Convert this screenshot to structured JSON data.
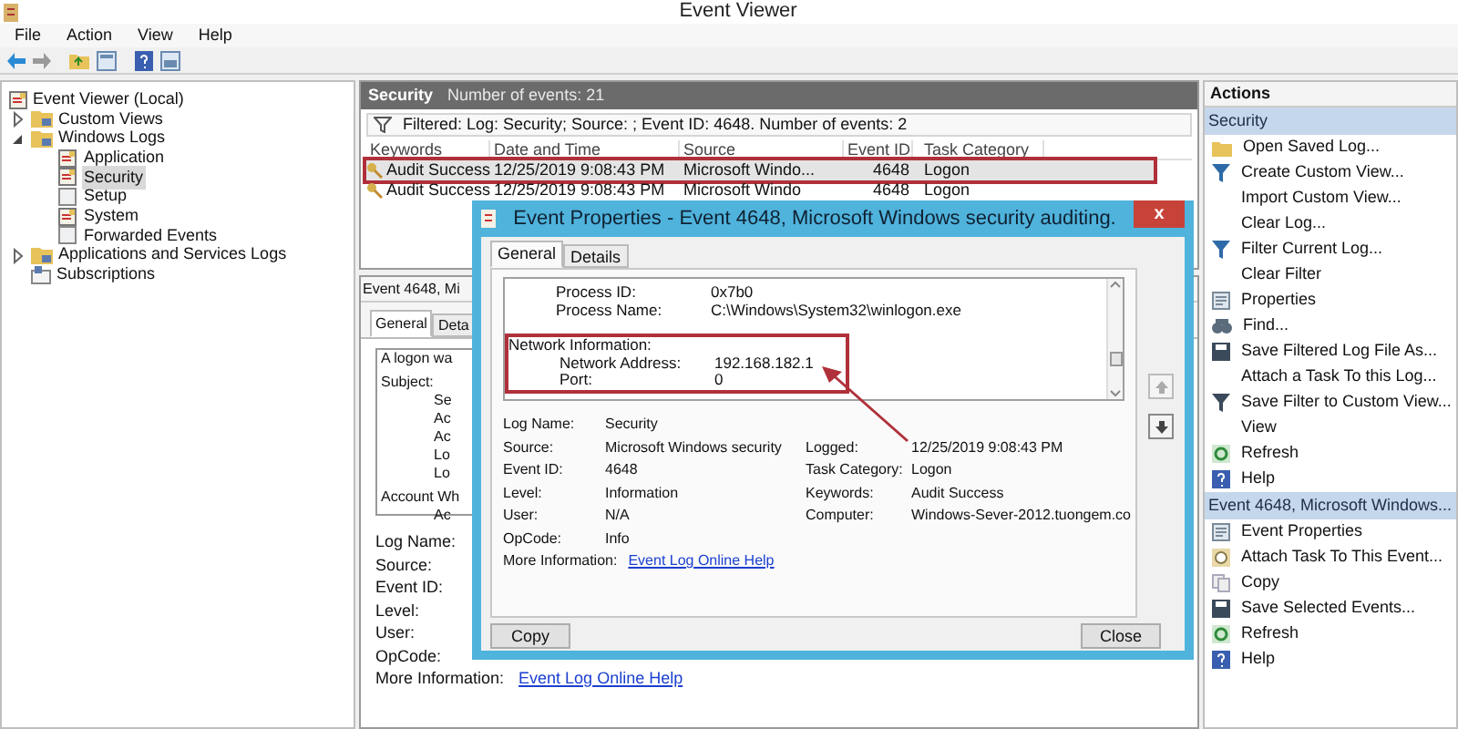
{
  "window": {
    "title": "Event Viewer"
  },
  "menu": [
    "File",
    "Action",
    "View",
    "Help"
  ],
  "tree": {
    "label": "Event Viewer (Local)",
    "children": [
      {
        "label": "Custom Views",
        "expanded": false,
        "kind": "folder"
      },
      {
        "label": "Windows Logs",
        "expanded": true,
        "kind": "folder",
        "children": [
          {
            "label": "Application",
            "selected": false,
            "kind": "log"
          },
          {
            "label": "Security",
            "selected": true,
            "kind": "log"
          },
          {
            "label": "Setup",
            "selected": false,
            "kind": "plain"
          },
          {
            "label": "System",
            "selected": false,
            "kind": "log"
          },
          {
            "label": "Forwarded Events",
            "selected": false,
            "kind": "plain"
          }
        ]
      },
      {
        "label": "Applications and Services Logs",
        "expanded": false,
        "kind": "folder"
      },
      {
        "label": "Subscriptions",
        "kind": "subscriptions"
      }
    ]
  },
  "log_pane": {
    "title": "Security",
    "count": "Number of events: 21",
    "filter": "Filtered: Log: Security; Source: ; Event ID: 4648. Number of events: 2",
    "columns": [
      "Keywords",
      "Date and Time",
      "Source",
      "Event ID",
      "Task Category"
    ],
    "rows": [
      {
        "cells": [
          "Audit Success",
          "12/25/2019 9:08:43 PM",
          "Microsoft Windo...",
          "4648",
          "Logon"
        ],
        "selected": true,
        "highlighted": true
      },
      {
        "cells": [
          "Audit Success",
          "12/25/2019 9:08:43 PM",
          "Microsoft Windo",
          "4648",
          "Logon"
        ],
        "selected": false,
        "highlighted": false
      }
    ]
  },
  "detail_pane": {
    "title": "Event 4648, Mi",
    "tabs": [
      {
        "label": "General",
        "selected": true
      },
      {
        "label": "Deta",
        "selected": false
      }
    ],
    "lines": [
      {
        "text": "A logon wa"
      },
      {
        "text": "Subject:",
        "children": [
          {
            "text": "Se"
          },
          {
            "text": "Ac"
          },
          {
            "text": "Ac"
          },
          {
            "text": "Lo"
          },
          {
            "text": "Lo"
          }
        ]
      },
      {
        "text": "Account Wh",
        "children": [
          {
            "text": "Ac"
          }
        ]
      }
    ],
    "fields": [
      "Log Name:",
      "Source:",
      "Event ID:",
      "Level:",
      "User:",
      "OpCode:"
    ],
    "more_label": "More Information:",
    "more_link": "Event Log Online Help"
  },
  "dialog": {
    "title": "Event Properties - Event 4648, Microsoft Windows security auditing.",
    "close": "x",
    "tabs": [
      {
        "label": "General",
        "selected": true
      },
      {
        "label": "Details",
        "selected": false
      }
    ],
    "event_text": [
      {
        "kind": "pair",
        "label": "Process ID:",
        "value": "0x7b0"
      },
      {
        "kind": "pair",
        "label": "Process Name:",
        "value": "C:\\Windows\\System32\\winlogon.exe"
      },
      {
        "kind": "highlight",
        "children": [
          {
            "kind": "heading",
            "label": "Network Information:"
          },
          {
            "kind": "pair",
            "label": "Network Address:",
            "value": "192.168.182.1"
          },
          {
            "kind": "pair",
            "label": "Port:",
            "value": "0"
          }
        ]
      }
    ],
    "field_rows": [
      [
        {
          "label": "Log Name:",
          "value": "Security"
        }
      ],
      [
        {
          "label": "Source:",
          "value": "Microsoft Windows security"
        },
        {
          "label": "Logged:",
          "value": "12/25/2019 9:08:43 PM"
        }
      ],
      [
        {
          "label": "Event ID:",
          "value": "4648"
        },
        {
          "label": "Task Category:",
          "value": "Logon"
        }
      ],
      [
        {
          "label": "Level:",
          "value": "Information"
        },
        {
          "label": "Keywords:",
          "value": "Audit Success"
        }
      ],
      [
        {
          "label": "User:",
          "value": "N/A"
        },
        {
          "label": "Computer:",
          "value": "Windows-Sever-2012.tuongem.co"
        }
      ],
      [
        {
          "label": "OpCode:",
          "value": "Info"
        }
      ],
      [
        {
          "label": "More Information:",
          "link": "Event Log Online Help"
        }
      ]
    ],
    "buttons": [
      "Copy",
      "Close"
    ]
  },
  "actions": {
    "title": "Actions",
    "sections": [
      {
        "title": "Security",
        "items": [
          {
            "label": "Open Saved Log...",
            "kind": "open"
          },
          {
            "label": "Create Custom View...",
            "kind": "filter"
          },
          {
            "label": "Import Custom View...",
            "kind": "none"
          },
          {
            "label": "Clear Log...",
            "kind": "none"
          },
          {
            "label": "Filter Current Log...",
            "kind": "filter"
          },
          {
            "label": "Clear Filter",
            "kind": "none"
          },
          {
            "label": "Properties",
            "kind": "properties"
          },
          {
            "label": "Find...",
            "kind": "find"
          },
          {
            "label": "Save Filtered Log File As...",
            "kind": "save"
          },
          {
            "label": "Attach a Task To this Log...",
            "kind": "none"
          },
          {
            "label": "Save Filter to Custom View...",
            "kind": "savefilter"
          },
          {
            "label": "View",
            "kind": "none"
          },
          {
            "label": "Refresh",
            "kind": "refresh"
          },
          {
            "label": "Help",
            "kind": "help"
          }
        ]
      },
      {
        "title": "Event 4648, Microsoft Windows...",
        "items": [
          {
            "label": "Event Properties",
            "kind": "properties"
          },
          {
            "label": "Attach Task To This Event...",
            "kind": "task"
          },
          {
            "label": "Copy",
            "kind": "copy"
          },
          {
            "label": "Save Selected Events...",
            "kind": "save"
          },
          {
            "label": "Refresh",
            "kind": "refresh"
          },
          {
            "label": "Help",
            "kind": "help"
          }
        ]
      }
    ]
  }
}
